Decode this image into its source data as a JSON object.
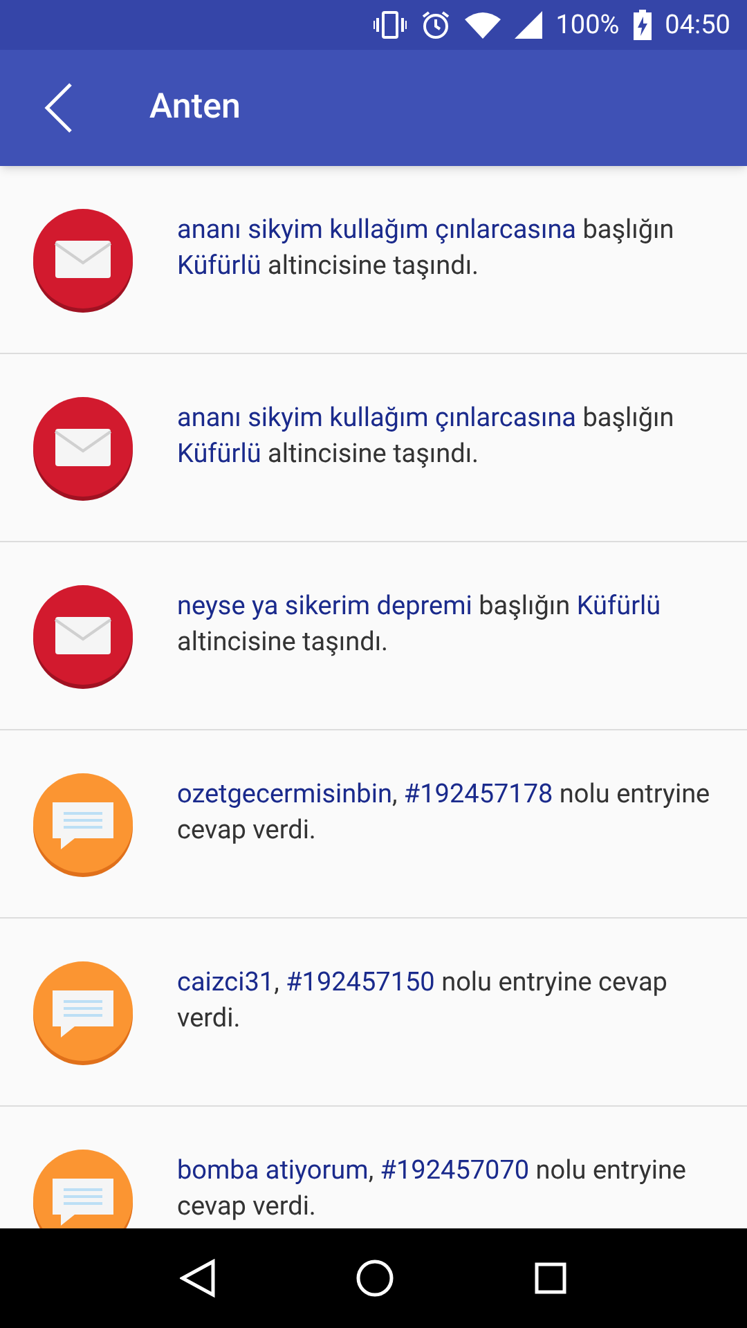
{
  "status_bar": {
    "battery": "100%",
    "time": "04:50"
  },
  "app_bar": {
    "title": "Anten"
  },
  "notifications": [
    {
      "kind": "message",
      "parts": [
        {
          "text": "ananı sikyim kullağım çınlarcasına",
          "link": true
        },
        {
          "text": " başlığın ",
          "link": false
        },
        {
          "text": "Küfürlü",
          "link": true
        },
        {
          "text": " altincisine taşındı.",
          "link": false
        }
      ]
    },
    {
      "kind": "message",
      "parts": [
        {
          "text": "ananı sikyim kullağım çınlarcasına",
          "link": true
        },
        {
          "text": " başlığın ",
          "link": false
        },
        {
          "text": "Küfürlü",
          "link": true
        },
        {
          "text": " altincisine taşındı.",
          "link": false
        }
      ]
    },
    {
      "kind": "message",
      "parts": [
        {
          "text": "neyse ya sikerim depremi",
          "link": true
        },
        {
          "text": " başlığın ",
          "link": false
        },
        {
          "text": "Küfürlü",
          "link": true
        },
        {
          "text": " altincisine taşındı.",
          "link": false
        }
      ]
    },
    {
      "kind": "reply",
      "parts": [
        {
          "text": "ozetgecermisinbin",
          "link": true
        },
        {
          "text": ", ",
          "link": false
        },
        {
          "text": "#192457178",
          "link": true
        },
        {
          "text": " nolu entryine cevap verdi.",
          "link": false
        }
      ]
    },
    {
      "kind": "reply",
      "parts": [
        {
          "text": "caizci31",
          "link": true
        },
        {
          "text": ", ",
          "link": false
        },
        {
          "text": "#192457150",
          "link": true
        },
        {
          "text": " nolu entryine cevap verdi.",
          "link": false
        }
      ]
    },
    {
      "kind": "reply",
      "parts": [
        {
          "text": "bomba atiyorum",
          "link": true
        },
        {
          "text": ", ",
          "link": false
        },
        {
          "text": "#192457070",
          "link": true
        },
        {
          "text": " nolu entryine cevap verdi.",
          "link": false
        }
      ]
    }
  ]
}
